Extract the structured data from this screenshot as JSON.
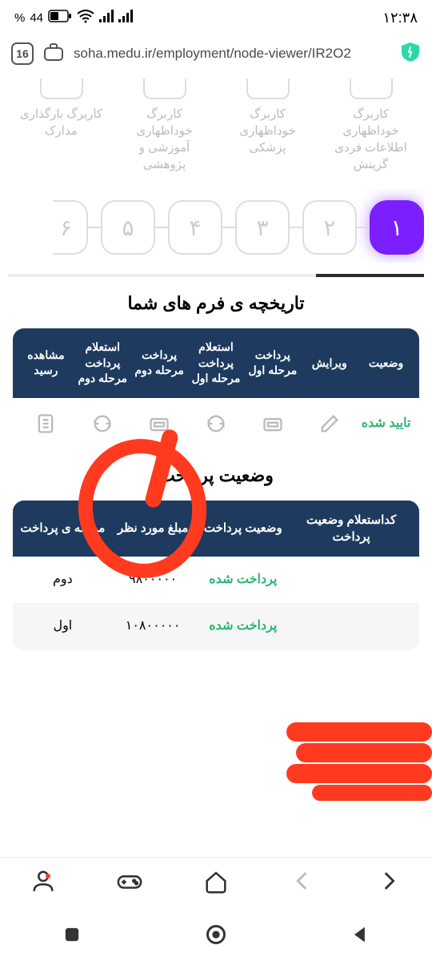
{
  "status_bar": {
    "battery_pct": "44",
    "pct_sign": "%",
    "time": "۱۲:۳۸"
  },
  "browser": {
    "tab_count": "16",
    "url": "soha.medu.ir/employment/node-viewer/IR2O2"
  },
  "top_tabs": [
    {
      "label": "کاربرگ خوداظهاری اطلاعات فردی گزینش"
    },
    {
      "label": "کاربرگ خوداظهاری پزشکی"
    },
    {
      "label": "کاربرگ خوداظهاری آموزشی و پژوهشی"
    },
    {
      "label": "کاربرگ بارگذاری مدارک"
    }
  ],
  "steps": [
    "۱",
    "۲",
    "۳",
    "۴",
    "۵",
    "۶"
  ],
  "section_history_title": "تاریخچه ی فرم های شما",
  "history_headers": [
    "وضعیت",
    "ویرایش",
    "پرداخت مرحله اول",
    "استعلام پرداخت مرحله اول",
    "پرداخت مرحله دوم",
    "استعلام پرداخت مرحله دوم",
    "مشاهده رسید"
  ],
  "history_row": {
    "status": "تایید شده"
  },
  "section_payment_title": "وضعیت پرداخت",
  "payment_headers": [
    "کداستعلام وضعیت پرداخت",
    "وضعیت پرداخت",
    "مبلغ مورد نظر",
    "مرحله ی پرداخت"
  ],
  "payment_rows": [
    {
      "code": "",
      "status": "پرداخت شده",
      "amount": "۹۸۰۰۰۰۰",
      "stage": "دوم"
    },
    {
      "code": "",
      "status": "پرداخت شده",
      "amount": "۱۰۸۰۰۰۰۰",
      "stage": "اول"
    }
  ]
}
